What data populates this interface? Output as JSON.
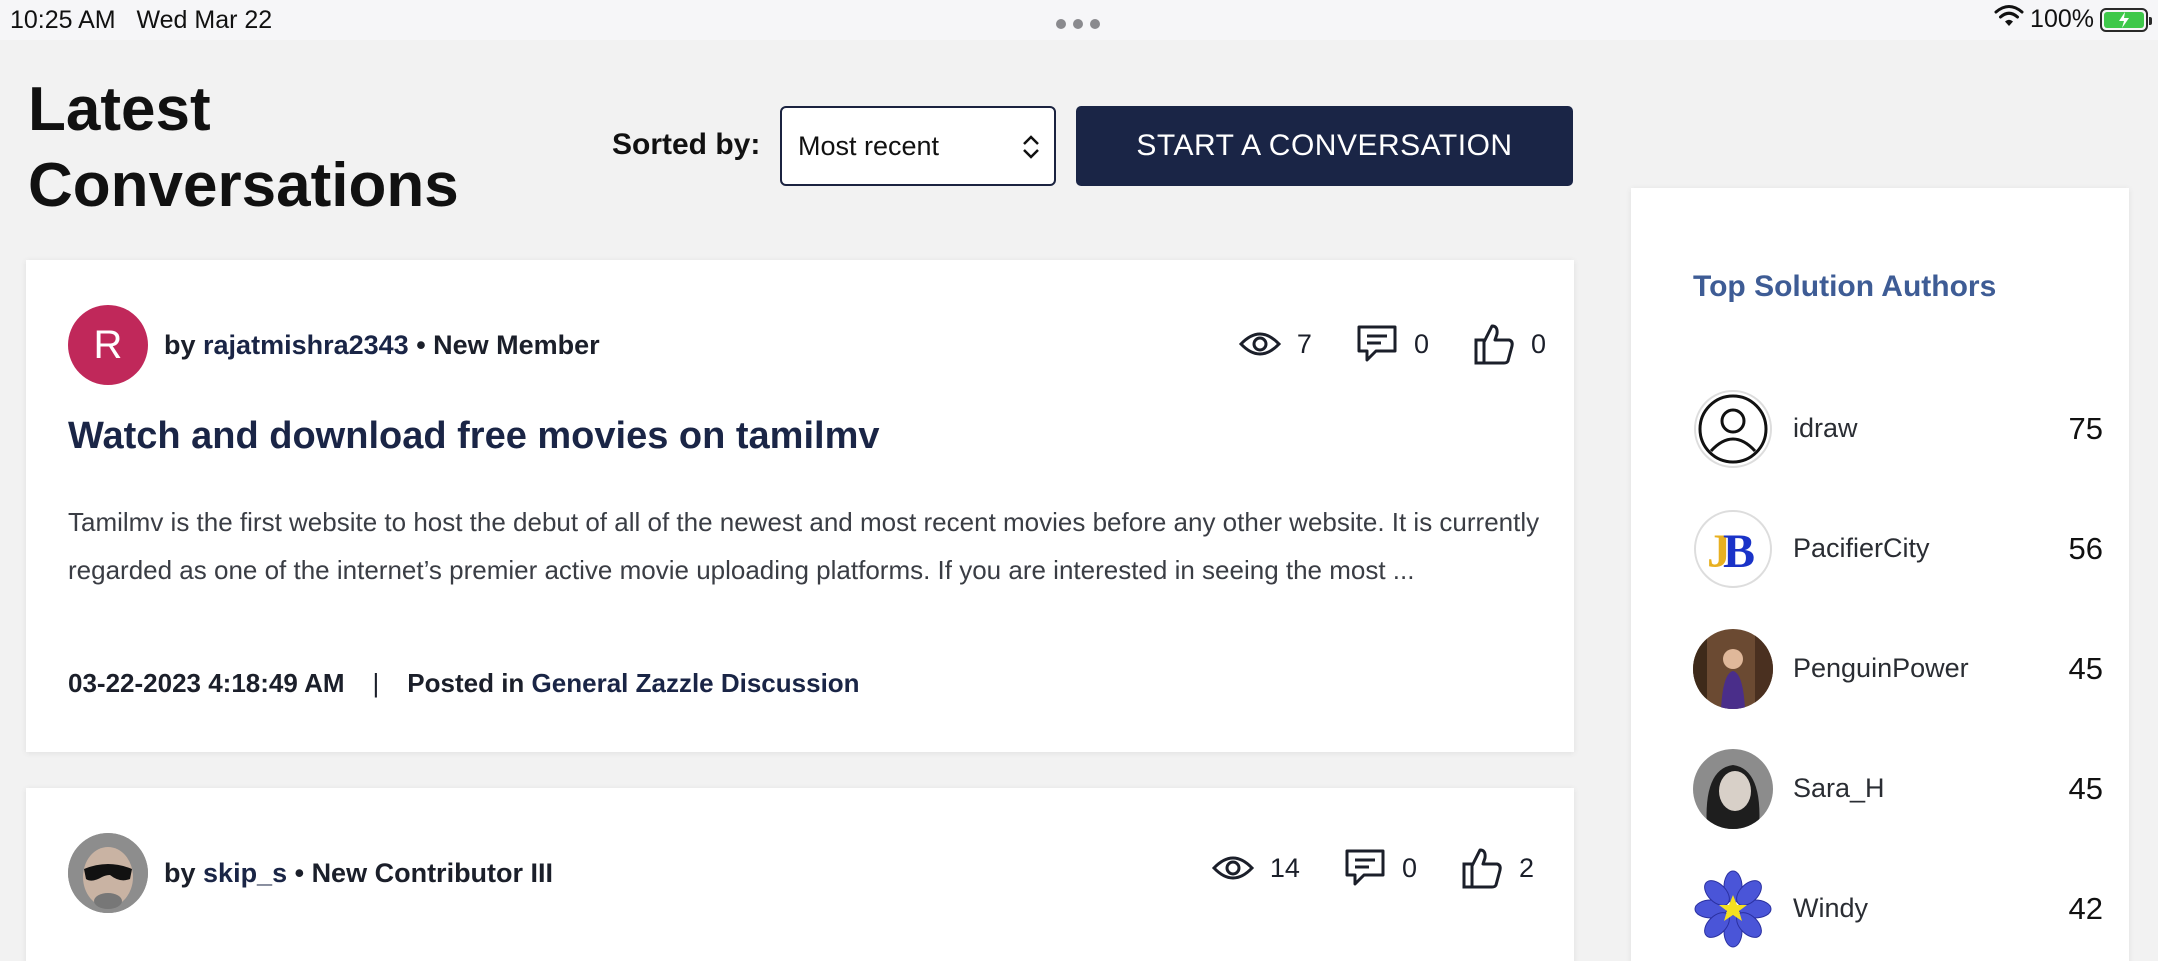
{
  "status_bar": {
    "time": "10:25 AM",
    "date": "Wed Mar 22",
    "battery": "100%",
    "icons": [
      "wifi-icon",
      "battery-icon",
      "multitasking-dots-icon"
    ]
  },
  "header": {
    "title": "Latest Conversations",
    "sort_label": "Sorted by:",
    "sort_value": "Most recent",
    "start_button": "START A CONVERSATION"
  },
  "posts": [
    {
      "avatar_letter": "R",
      "avatar_color": "#c0285a",
      "by": "by",
      "author": "rajatmishra2343",
      "rank": "• New Member",
      "views": "7",
      "replies": "0",
      "kudos": "0",
      "title": "Watch and download free movies on tamilmv",
      "excerpt": "Tamilmv is the first website to host the debut of all of the newest and most recent movies before any other website. It is currently regarded as one of the internet’s premier active movie uploading platforms. If you are interested in seeing the most ...",
      "date": "03-22-2023 4:18:49 AM",
      "separator": "|",
      "posted_in": "Posted in",
      "board": "General Zazzle Discussion"
    },
    {
      "by": "by",
      "author": "skip_s",
      "rank": "• New Contributor III",
      "views": "14",
      "replies": "0",
      "kudos": "2"
    }
  ],
  "sidebar": {
    "title": "Top Solution Authors",
    "authors": [
      {
        "name": "idraw",
        "count": "75"
      },
      {
        "name": "PacifierCity",
        "count": "56"
      },
      {
        "name": "PenguinPower",
        "count": "45"
      },
      {
        "name": "Sara_H",
        "count": "45"
      },
      {
        "name": "Windy",
        "count": "42"
      }
    ]
  },
  "colors": {
    "primary": "#1a2546",
    "sidebar_heading": "#3e5c95",
    "avatar_r": "#c0285a",
    "battery": "#3ec84a"
  }
}
